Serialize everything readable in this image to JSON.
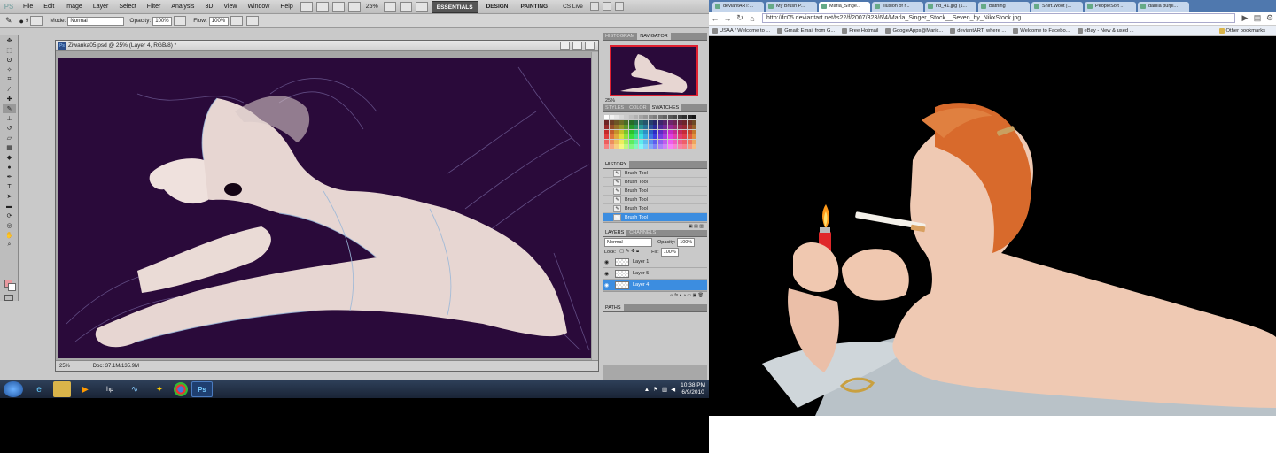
{
  "photoshop": {
    "logo": "PS",
    "menu": [
      "File",
      "Edit",
      "Image",
      "Layer",
      "Select",
      "Filter",
      "Analysis",
      "3D",
      "View",
      "Window",
      "Help"
    ],
    "zoom": "25%",
    "workspaces": {
      "essentials": "ESSENTIALS",
      "design": "DESIGN",
      "painting": "PAINTING"
    },
    "cs_live": "CS Live",
    "options": {
      "brush_size": "9",
      "mode_label": "Mode:",
      "mode_value": "Normal",
      "opacity_label": "Opacity:",
      "opacity_value": "100%",
      "flow_label": "Flow:",
      "flow_value": "100%"
    },
    "document": {
      "title": "Ziwanka05.psd @ 25% (Layer 4, RGB/8) *",
      "zoom": "25%",
      "doc_info": "Doc: 37.1M/135.9M"
    },
    "panels": {
      "navigator_tabs": [
        "HISTOGRAM",
        "NAVIGATOR"
      ],
      "navigator_zoom": "25%",
      "swatch_tabs": [
        "STYLES",
        "COLOR",
        "SWATCHES"
      ],
      "history_tab": "HISTORY",
      "history_items": [
        "Brush Tool",
        "Brush Tool",
        "Brush Tool",
        "Brush Tool",
        "Brush Tool",
        "Brush Tool"
      ],
      "layers_tabs": [
        "LAYERS",
        "CHANNELS"
      ],
      "blend_mode": "Normal",
      "opacity_label": "Opacity:",
      "opacity_value": "100%",
      "lock_label": "Lock:",
      "fill_label": "Fill:",
      "fill_value": "100%",
      "layers": [
        "Layer 1",
        "Layer 5",
        "Layer 4"
      ],
      "paths_tab": "PATHS"
    },
    "colors": {
      "foreground": "#e89aa0",
      "background": "#ffffff",
      "canvas": "#2a0a3a"
    }
  },
  "taskbar": {
    "clock_time": "10:38 PM",
    "clock_date": "6/9/2010",
    "apps": [
      "ie-icon",
      "folder-icon",
      "media-player-icon",
      "hp-icon",
      "chart-icon",
      "aim-icon",
      "chrome-icon",
      "photoshop-icon"
    ],
    "photoshop_label": "Ps"
  },
  "chrome": {
    "tabs": [
      "deviantART:...",
      "My Brush P...",
      "Marla_Singe...",
      "illusion of r...",
      "hd_41.jpg (1...",
      "Bathing",
      "Shirt.Woot |...",
      "PeopleSoft ...",
      "dahlia purpl..."
    ],
    "url": "http://fc05.deviantart.net/fs22/f/2007/323/6/4/Marla_Singer_Stock__Seven_by_NikxStock.jpg",
    "bookmarks": [
      "USAA / Welcome to ...",
      "Gmail: Email from G...",
      "Free Hotmail",
      "GoogleApps@Maric...",
      "deviantART: where ...",
      "Welcome to Facebo...",
      "eBay - New & used ..."
    ],
    "other_bookmarks": "Other bookmarks"
  }
}
